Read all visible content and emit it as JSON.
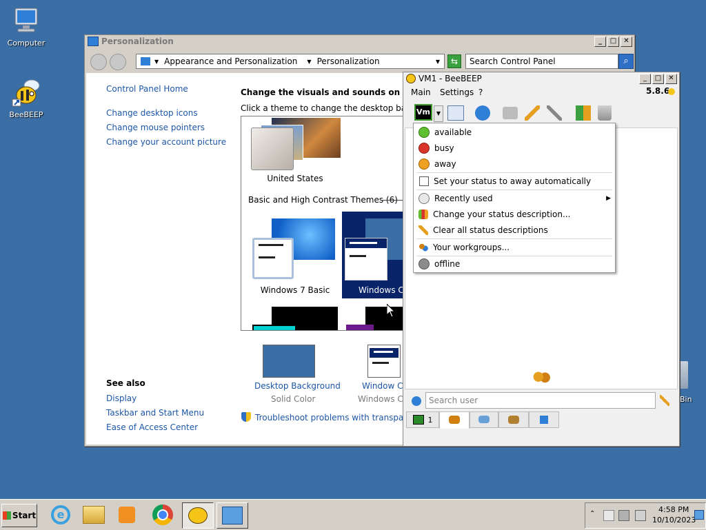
{
  "desktop": {
    "icons": [
      {
        "label": "Computer"
      },
      {
        "label": "BeeBEEP"
      },
      {
        "label": "Bin"
      }
    ]
  },
  "personalization": {
    "title": "Personalization",
    "breadcrumb": [
      "Appearance and Personalization",
      "Personalization"
    ],
    "search_placeholder": "Search Control Panel",
    "left_links": [
      "Control Panel Home",
      "Change desktop icons",
      "Change mouse pointers",
      "Change your account picture"
    ],
    "see_also_heading": "See also",
    "see_also": [
      "Display",
      "Taskbar and Start Menu",
      "Ease of Access Center"
    ],
    "heading": "Change the visuals and sounds on your co",
    "subheading": "Click a theme to change the desktop background",
    "theme_united_states": "United States",
    "basic_heading": "Basic and High Contrast Themes (6)",
    "theme_win7_basic": "Windows 7 Basic",
    "theme_win_classic": "Windows Cl",
    "bottom_items": [
      {
        "label": "Desktop Background",
        "sub": "Solid Color"
      },
      {
        "label": "Window Colo",
        "sub": "Windows Clas"
      }
    ],
    "troubleshoot": "Troubleshoot problems with transparency ar"
  },
  "beebeep": {
    "title": "VM1 - BeeBEEP",
    "version": "5.8.6",
    "menu": [
      "Main",
      "Settings",
      "?"
    ],
    "status_badge": "Vm",
    "status_menu": [
      {
        "label": "available",
        "color": "#5fbf2f"
      },
      {
        "label": "busy",
        "color": "#d9342b"
      },
      {
        "label": "away",
        "color": "#f0a020"
      },
      {
        "label": "Set your status to away automatically"
      },
      {
        "label": "Recently used"
      },
      {
        "label": "Change your status description..."
      },
      {
        "label": "Clear all status descriptions"
      },
      {
        "label": "Your workgroups..."
      },
      {
        "label": "offline",
        "color": "#8c8c8c"
      }
    ],
    "search_placeholder": "Search user",
    "tab_count": "1"
  },
  "taskbar": {
    "start_label": "Start",
    "time": "4:58 PM",
    "date": "10/10/2023"
  },
  "colors": {
    "desktop": "#3b6ea5",
    "link": "#1c56a8",
    "classic_blue": "#0a246a"
  }
}
